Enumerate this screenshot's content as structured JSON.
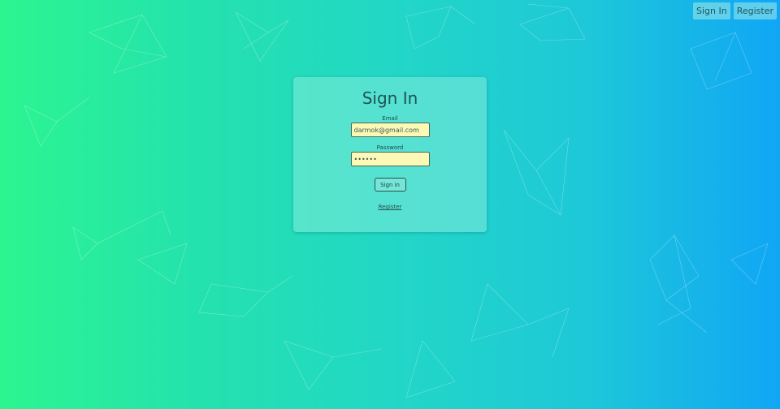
{
  "nav": {
    "signin_label": "Sign In",
    "register_label": "Register"
  },
  "form": {
    "title": "Sign In",
    "email_label": "Email",
    "email_value": "darmok@gmail.com",
    "password_label": "Password",
    "password_value": "••••••",
    "submit_label": "Sign in",
    "register_link": "Register"
  },
  "colors": {
    "gradient_left": "#2cf590",
    "gradient_right": "#10a6f5",
    "input_background": "#fcf9b7",
    "text": "#1d5354"
  }
}
